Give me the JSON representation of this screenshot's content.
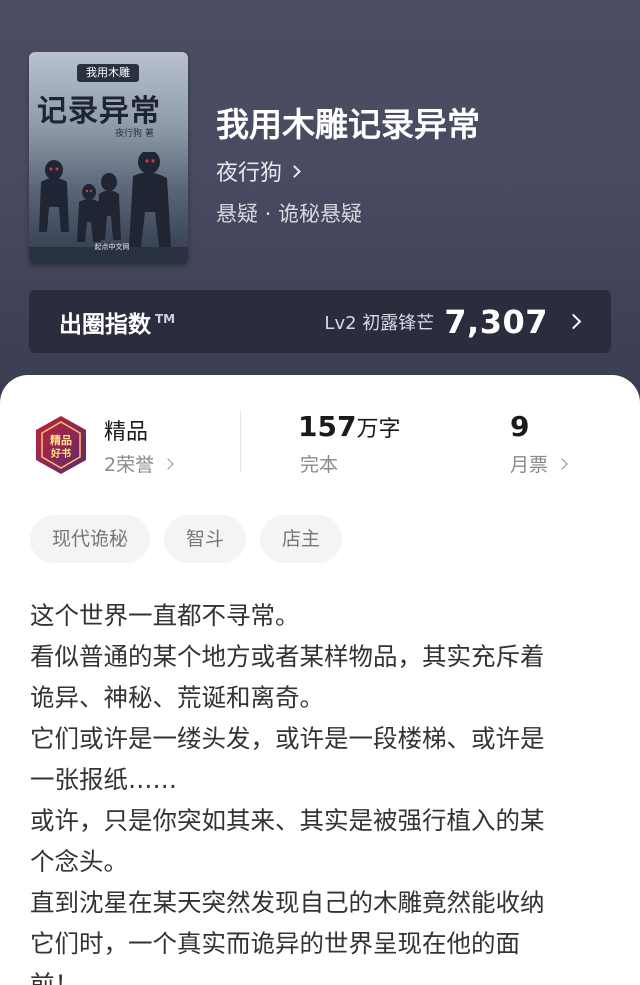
{
  "book": {
    "cover": {
      "series_label": "我用木雕",
      "title": "记录异常",
      "author": "夜行狗 著",
      "publisher": "起点中文网"
    },
    "title": "我用木雕记录异常",
    "author": "夜行狗",
    "genre": "悬疑 · 诡秘悬疑"
  },
  "index": {
    "label": "出圈指数",
    "tm": "TM",
    "level": "Lv2 初露锋芒",
    "value": "7,307"
  },
  "stats": {
    "quality": {
      "title": "精品",
      "sub": "2荣誉",
      "badge_text": "精品好书"
    },
    "words": {
      "value": "157",
      "unit": "万字",
      "sub": "完本"
    },
    "tickets": {
      "value": "9",
      "sub": "月票"
    }
  },
  "tags": [
    "现代诡秘",
    "智斗",
    "店主"
  ],
  "synopsis": [
    "这个世界一直都不寻常。",
    "看似普通的某个地方或者某样物品，其实充斥着",
    "诡异、神秘、荒诞和离奇。",
    "它们或许是一缕头发，或许是一段楼梯、或许是",
    "一张报纸……",
    "或许，只是你突如其来、其实是被强行植入的某",
    "个念头。",
    "直到沈星在某天突然发现自己的木雕竟然能收纳",
    "它们时，一个真实而诡异的世界呈现在他的面",
    "前！"
  ],
  "colors": {
    "hero_bg": "#4a4b62",
    "index_bar": "#2a2b3b",
    "badge_red": "#b3243a",
    "badge_purple": "#5b2a6e"
  }
}
